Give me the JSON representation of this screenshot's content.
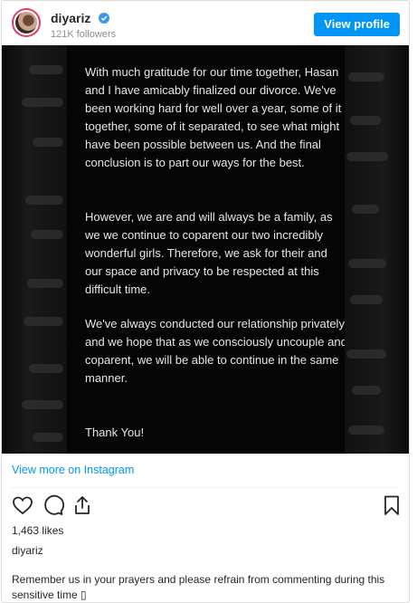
{
  "header": {
    "username": "diyariz",
    "followers": "121K followers",
    "view_profile_label": "View profile"
  },
  "post": {
    "paragraphs": [
      "With much gratitude for our time together, Hasan and I have amicably finalized our divorce. We've been working hard for well over a year, some of it together, some of it separated, to see what might have been possible between us. And the final conclusion is to part our ways for the best.",
      "However, we are and will always be a family, as we we continue to coparent our two incredibly wonderful girls. Therefore, we ask for their and our space and privacy to be respected at this difficult time.",
      "We've always conducted our relationship privately, and we hope that as we consciously uncouple and coparent, we will be able to continue in the same manner.",
      "Thank You!"
    ]
  },
  "view_more_label": "View more on Instagram",
  "actions": {
    "icons": [
      "heart-icon",
      "comment-icon",
      "share-icon",
      "bookmark-icon"
    ]
  },
  "likes": "1,463 likes",
  "author": "diyariz",
  "caption": "Remember us in your prayers and please refrain from commenting during this sensitive time ▯",
  "colors": {
    "accent": "#0095f6",
    "verified": "#3897f0",
    "image_bg": "#000000",
    "text": "#262626"
  }
}
